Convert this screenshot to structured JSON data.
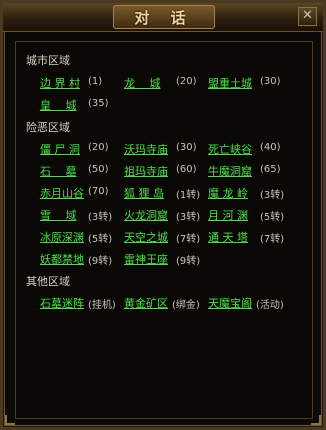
{
  "window": {
    "title": "对 话",
    "close_label": "✕"
  },
  "sections": {
    "city": {
      "title": "城市区域"
    },
    "danger": {
      "title": "险恶区域"
    },
    "other": {
      "title": "其他区域"
    }
  },
  "city_links": [
    {
      "name": "边 界 村",
      "note": "(1)"
    },
    {
      "name": "龙　 城",
      "note": "(20)"
    },
    {
      "name": "盟重土城",
      "note": "(30)"
    },
    {
      "name": "皇　 城",
      "note": "(35)"
    }
  ],
  "danger_links": [
    {
      "name": "僵 尸 洞",
      "note": "(20)"
    },
    {
      "name": "沃玛寺庙",
      "note": "(30)"
    },
    {
      "name": "死亡峡谷",
      "note": "(40)"
    },
    {
      "name": "石　 墓",
      "note": "(50)"
    },
    {
      "name": "祖玛寺庙",
      "note": "(60)"
    },
    {
      "name": "牛魔洞窟",
      "note": "(65)"
    },
    {
      "name": "赤月山谷",
      "note": "(70)"
    },
    {
      "name": "狐 狸 岛",
      "note": "(1转)"
    },
    {
      "name": "魔 龙 岭",
      "note": "(3转)"
    },
    {
      "name": "雪　 域",
      "note": "(3转)"
    },
    {
      "name": "火龙洞窟",
      "note": "(3转)"
    },
    {
      "name": "月 河 渊",
      "note": "(5转)"
    },
    {
      "name": "冰原深渊",
      "note": "(5转)"
    },
    {
      "name": "天空之城",
      "note": "(7转)"
    },
    {
      "name": "通 天 塔",
      "note": "(7转)"
    },
    {
      "name": "妖都禁地",
      "note": "(9转)"
    },
    {
      "name": "雷神王座",
      "note": "(9转)"
    }
  ],
  "other_links": [
    {
      "name": "石墓迷阵",
      "note": "(挂机)"
    },
    {
      "name": "黄金矿区",
      "note": "(绑金)"
    },
    {
      "name": "天魔宝阁",
      "note": "(活动)"
    }
  ]
}
